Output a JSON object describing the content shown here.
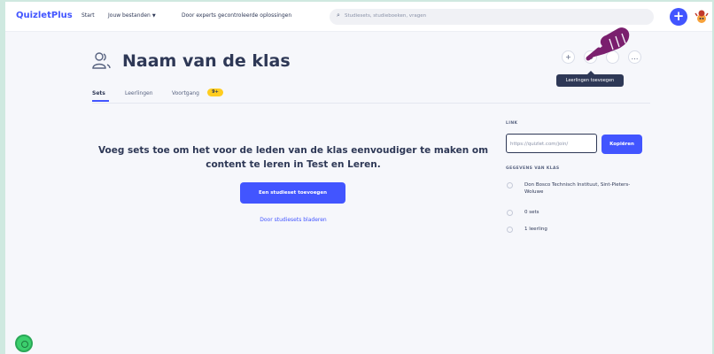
{
  "topbar": {
    "logo": "QuizletPlus",
    "nav": [
      "Start",
      "Jouw bestanden",
      "Door experts gecontroleerde oplossingen"
    ],
    "search_placeholder": "Studiesets, studieboeken, vragen"
  },
  "class": {
    "title": "Naam van de klas",
    "tooltip": "Leerlingen toevoegen",
    "action_buttons": [
      "+",
      "⊕",
      "",
      "…"
    ]
  },
  "tabs": {
    "sets": "Sets",
    "students": "Leerlingen",
    "progress": "Voortgang",
    "progress_badge": "9+"
  },
  "main": {
    "empty_message": "Voeg sets toe om het voor de leden van de klas eenvoudiger te maken om content te leren in Test en Leren.",
    "primary_button": "Een studieset toevoegen",
    "browse_link": "Door studiesets bladeren"
  },
  "sidebar": {
    "link_label": "LINK",
    "link_value": "https://quizlet.com/join/",
    "copy_button": "Kopiëren",
    "details_label": "GEGEVENS VAN KLAS",
    "details": [
      "Don Bosco Technisch Instituut, Sint-Pieters-Woluwe",
      "0 sets",
      "1 leerling"
    ]
  },
  "colors": {
    "accent": "#4255ff",
    "badge": "#ffcd1f",
    "cursor_hand": "#7a1f6e",
    "help_button": "#3ccf6d"
  }
}
